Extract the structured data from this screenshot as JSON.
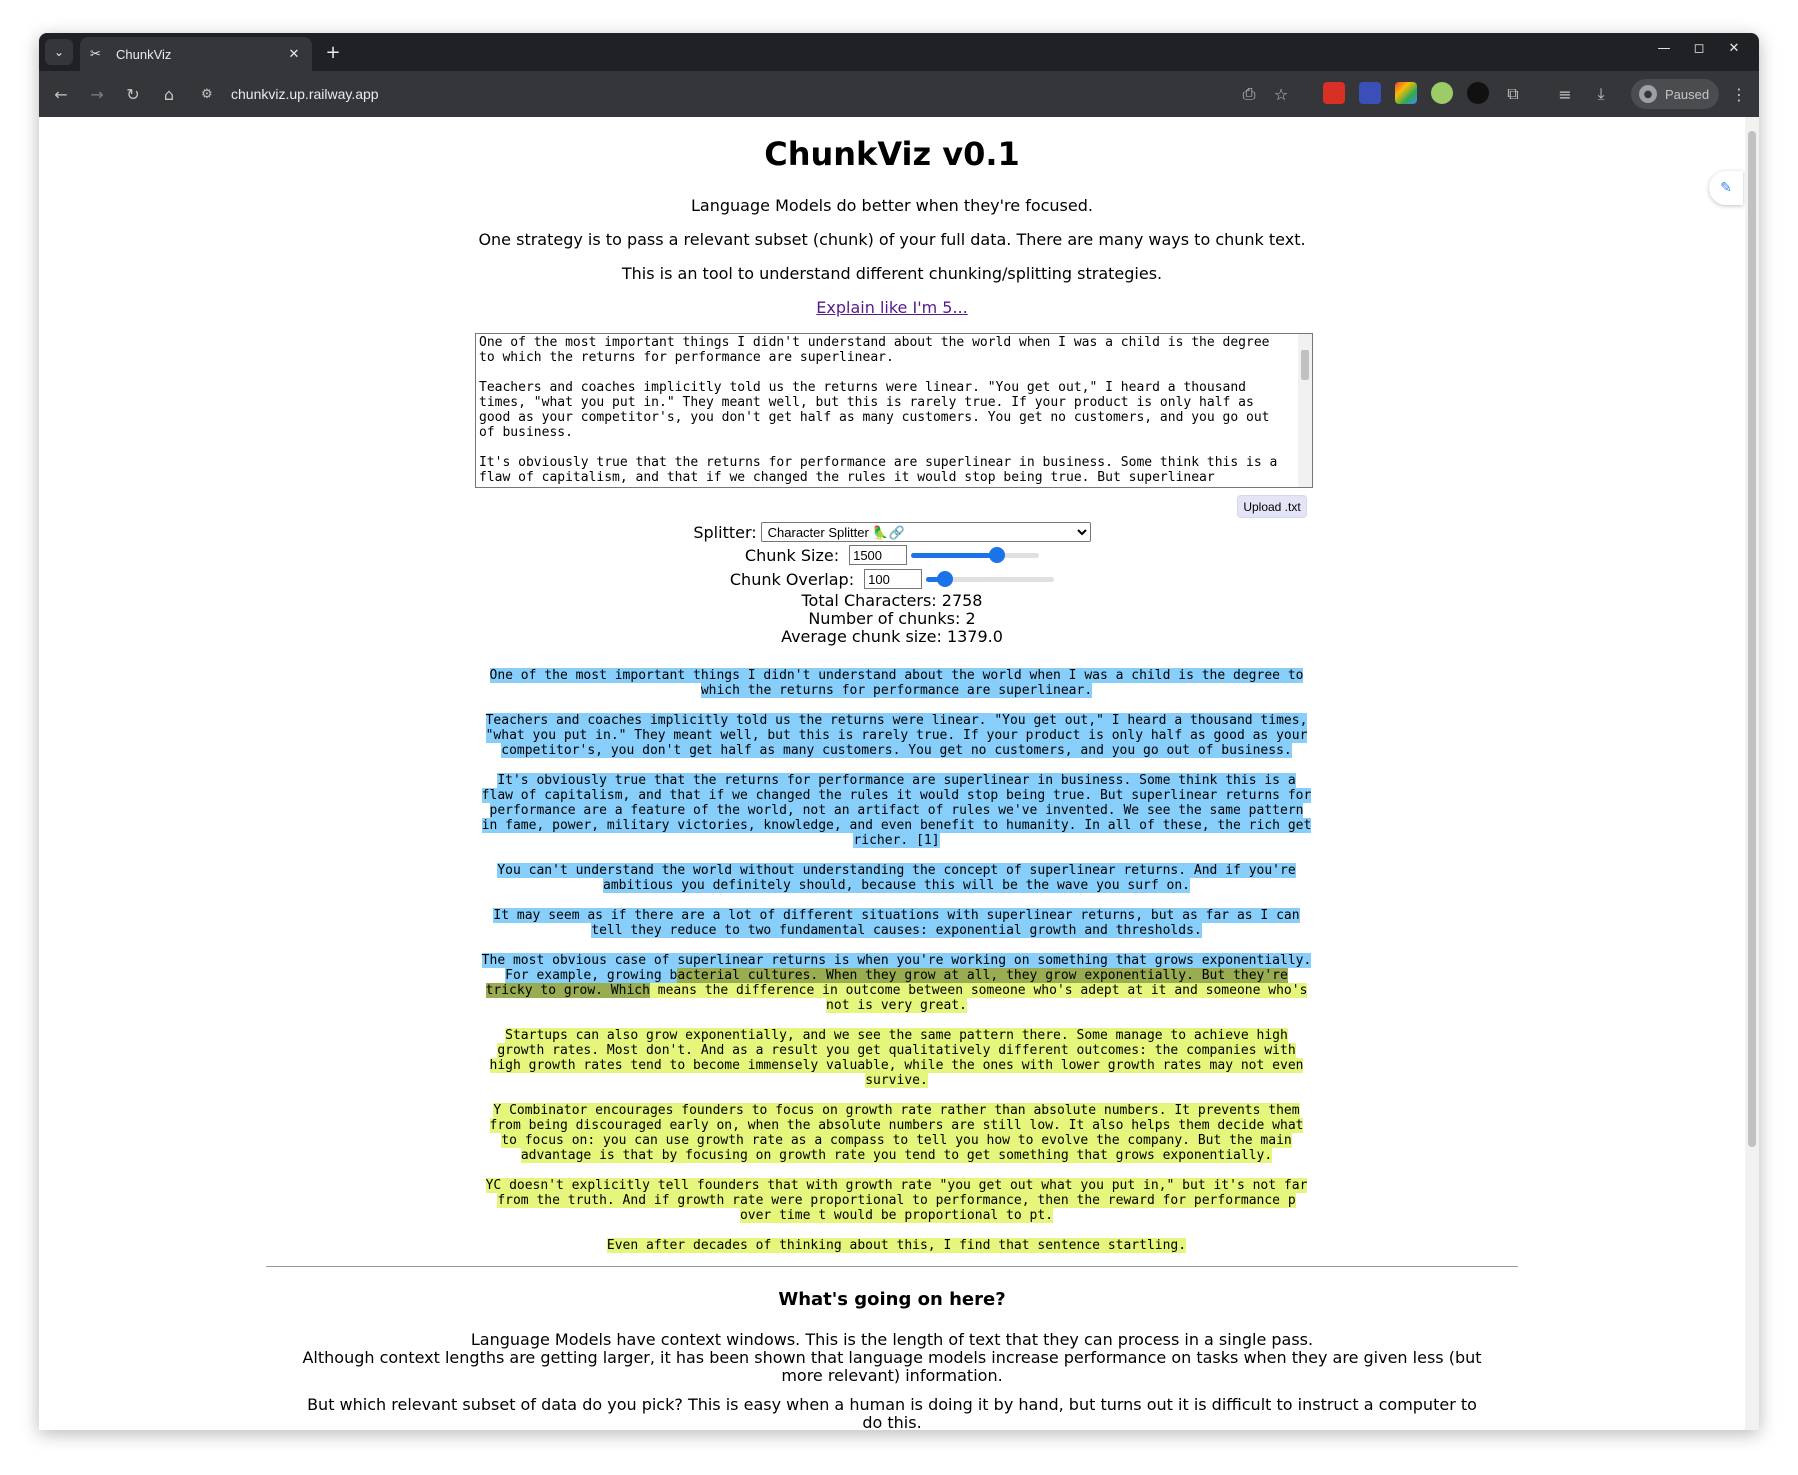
{
  "browser": {
    "tab_title": "ChunkViz",
    "url": "chunkviz.up.railway.app",
    "profile_label": "Paused"
  },
  "page": {
    "title": "ChunkViz v0.1",
    "intro_1": "Language Models do better when they're focused.",
    "intro_2": "One strategy is to pass a relevant subset (chunk) of your full data. There are many ways to chunk text.",
    "intro_3": "This is an tool to understand different chunking/splitting strategies.",
    "eli5_link": "Explain like I'm 5...",
    "textarea_value": "One of the most important things I didn't understand about the world when I was a child is the degree to which the returns for performance are superlinear.\n\nTeachers and coaches implicitly told us the returns were linear. \"You get out,\" I heard a thousand times, \"what you put in.\" They meant well, but this is rarely true. If your product is only half as good as your competitor's, you don't get half as many customers. You get no customers, and you go out of business.\n\nIt's obviously true that the returns for performance are superlinear in business. Some think this is a flaw of capitalism, and that if we changed the rules it would stop being true. But superlinear",
    "upload_label": "Upload .txt",
    "splitter_label": "Splitter:",
    "splitter_value": "Character Splitter 🦜🔗",
    "chunk_size_label": "Chunk Size:",
    "chunk_size_value": "1500",
    "chunk_size_fraction": 0.67,
    "chunk_overlap_label": "Chunk Overlap:",
    "chunk_overlap_value": "100",
    "chunk_overlap_fraction": 0.15,
    "total_characters": "Total Characters: 2758",
    "number_of_chunks": "Number of chunks: 2",
    "average_chunk_size": "Average chunk size: 1379.0",
    "chunk_colors": {
      "chunk1": "#87cefa",
      "chunk2": "#e6f57b",
      "overlap": "#9aac52"
    },
    "chunks": {
      "p1": "One of the most important things I didn't understand about the world when I was a child is the degree to which the returns for performance are superlinear.",
      "p2": "Teachers and coaches implicitly told us the returns were linear. \"You get out,\" I heard a thousand times, \"what you put in.\" They meant well, but this is rarely true. If your product is only half as good as your competitor's, you don't get half as many customers. You get no customers, and you go out of business.",
      "p3": "It's obviously true that the returns for performance are superlinear in business. Some think this is a flaw of capitalism, and that if we changed the rules it would stop being true. But superlinear returns for performance are a feature of the world, not an artifact of rules we've invented. We see the same pattern in fame, power, military victories, knowledge, and even benefit to humanity. In all of these, the rich get richer. [1]",
      "p4": "You can't understand the world without understanding the concept of superlinear returns. And if you're ambitious you definitely should, because this will be the wave you surf on.",
      "p5": "It may seem as if there are a lot of different situations with superlinear returns, but as far as I can tell they reduce to two fundamental causes: exponential growth and thresholds.",
      "p6_a": "The most obvious case of superlinear returns is when you're working on something that grows exponentially. For example, growing b",
      "p6_b": "acterial cultures. When they grow at all, they grow exponentially. But they're tricky to grow. Which",
      "p6_c": " means the difference in outcome between someone who's adept at it and someone who's not is very great.",
      "p7": "Startups can also grow exponentially, and we see the same pattern there. Some manage to achieve high growth rates. Most don't. And as a result you get qualitatively different outcomes: the companies with high growth rates tend to become immensely valuable, while the ones with lower growth rates may not even survive.",
      "p8": "Y Combinator encourages founders to focus on growth rate rather than absolute numbers. It prevents them from being discouraged early on, when the absolute numbers are still low. It also helps them decide what to focus on: you can use growth rate as a compass to tell you how to evolve the company. But the main advantage is that by focusing on growth rate you tend to get something that grows exponentially.",
      "p9": "YC doesn't explicitly tell founders that with growth rate \"you get out what you put in,\" but it's not far from the truth. And if growth rate were proportional to performance, then the reward for performance p over time t would be proportional to pt.",
      "p10": "Even after decades of thinking about this, I find that sentence startling."
    },
    "section_heading": "What's going on here?",
    "explain_1": "Language Models have context windows. This is the length of text that they can process in a single pass.",
    "explain_2": "Although context lengths are getting larger, it has been shown that language models increase performance on tasks when they are given less (but more relevant) information.",
    "explain_3": "But which relevant subset of data do you pick? This is easy when a human is doing it by hand, but turns out it is difficult to instruct a computer to do this."
  },
  "icons": {
    "tab_search": "⌄",
    "tab_favicon": "✂",
    "tab_close": "✕",
    "new_tab": "+",
    "minimize": "—",
    "maximize": "◻",
    "close_window": "✕",
    "back": "←",
    "forward": "→",
    "reload": "↻",
    "home": "⌂",
    "site_info": "⚙",
    "install": "⎙",
    "star": "☆",
    "extensions": "⧉",
    "media": "≡",
    "download": "⤓",
    "menu": "⋮",
    "profile": "●",
    "side_panel": "✎"
  }
}
